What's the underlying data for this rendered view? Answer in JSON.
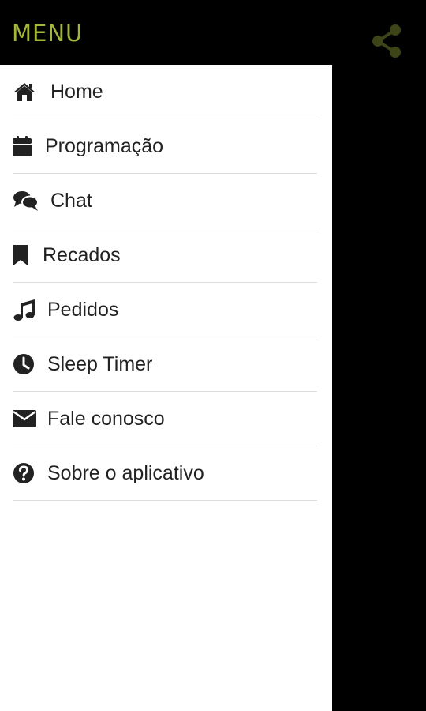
{
  "header": {
    "title": "MENU",
    "share_icon": "share-icon",
    "accent_color": "#a4b53a",
    "share_icon_color": "#3d4417"
  },
  "menu": {
    "items": [
      {
        "label": "Home",
        "icon": "home-icon"
      },
      {
        "label": "Programação",
        "icon": "calendar-icon"
      },
      {
        "label": "Chat",
        "icon": "chat-bubbles-icon"
      },
      {
        "label": "Recados",
        "icon": "bookmark-icon"
      },
      {
        "label": "Pedidos",
        "icon": "music-note-icon"
      },
      {
        "label": "Sleep Timer",
        "icon": "clock-icon"
      },
      {
        "label": "Fale conosco",
        "icon": "envelope-icon"
      },
      {
        "label": "Sobre o aplicativo",
        "icon": "question-circle-icon"
      }
    ]
  }
}
